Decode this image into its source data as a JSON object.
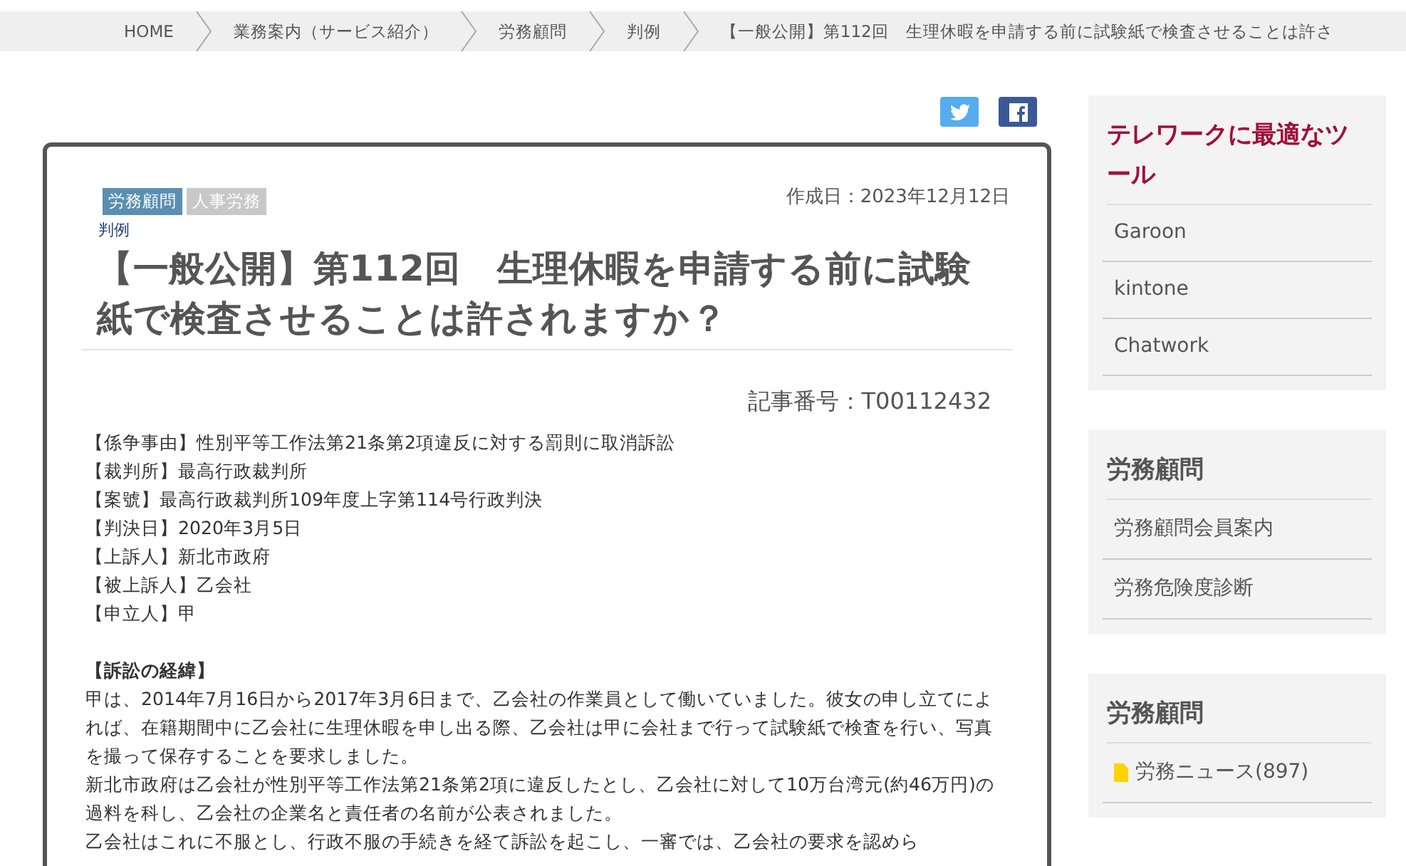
{
  "breadcrumb": [
    "HOME",
    "業務案内（サービス紹介）",
    "労務顧問",
    "判例",
    "【一般公開】第112回　生理休暇を申請する前に試験紙で検査させることは許さ"
  ],
  "share": [
    {
      "kind": "twitter"
    },
    {
      "kind": "facebook"
    }
  ],
  "article": {
    "tags": [
      {
        "label": "労務顧問",
        "color": "#5b8fb0"
      },
      {
        "label": "人事労務",
        "color": "#c8c8c8"
      }
    ],
    "date": "作成日：2023年12月12日",
    "category": "判例",
    "title": "【一般公開】第112回　生理休暇を申請する前に試験紙で検査させることは許されますか？",
    "number": "記事番号：T00112432",
    "body": [
      {
        "kind": "line",
        "text": "【係争事由】性別平等工作法第21条第2項違反に対する罰則に取消訴訟"
      },
      {
        "kind": "line",
        "text": "【裁判所】最高行政裁判所"
      },
      {
        "kind": "line",
        "text": "【案號】最高行政裁判所109年度上字第114号行政判決"
      },
      {
        "kind": "line",
        "text": "【判決日】2020年3月5日"
      },
      {
        "kind": "line",
        "text": "【上訴人】新北市政府"
      },
      {
        "kind": "line",
        "text": "【被上訴人】乙会社"
      },
      {
        "kind": "line",
        "text": "【申立人】甲"
      },
      {
        "kind": "heading",
        "text": "【訴訟の経緯】"
      },
      {
        "kind": "paragraph",
        "text": "甲は、2014年7月16日から2017年3月6日まで、乙会社の作業員として働いていました。彼女の申し立てによれば、在籍期間中に乙会社に生理休暇を申し出る際、乙会社は甲に会社まで行って試験紙で検査を行い、写真を撮って保存することを要求しました。"
      },
      {
        "kind": "paragraph",
        "text": "新北市政府は乙会社が性別平等工作法第21条第2項に違反したとし、乙会社に対して10万台湾元(約46万円)の過料を科し、乙会社の企業名と責任者の名前が公表されました。"
      },
      {
        "kind": "paragraph",
        "text": "乙会社はこれに不服とし、行政不服の手続きを経て訴訟を起こし、一審では、乙会社の要求を認めら"
      }
    ]
  },
  "sidebar": [
    {
      "title": "テレワークに最適なツール",
      "color": "#a0103a",
      "items": [
        {
          "kind": "link",
          "label": "Garoon"
        },
        {
          "kind": "link",
          "label": "kintone"
        },
        {
          "kind": "link",
          "label": "Chatwork"
        }
      ]
    },
    {
      "title": "労務顧問",
      "color": "#555555",
      "items": [
        {
          "kind": "link",
          "label": "労務顧問会員案内"
        },
        {
          "kind": "link",
          "label": "労務危険度診断"
        }
      ]
    },
    {
      "title": "労務顧問",
      "color": "#555555",
      "items": [
        {
          "kind": "category",
          "label": "労務ニュース(897)"
        }
      ]
    }
  ]
}
